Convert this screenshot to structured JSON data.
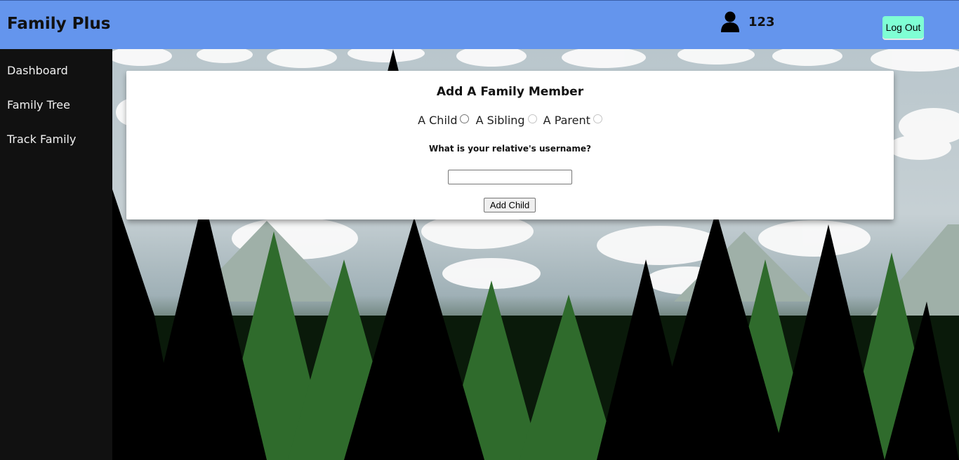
{
  "header": {
    "brand": "Family Plus",
    "user_icon": "user-icon",
    "username": "123",
    "logout_label": "Log Out"
  },
  "sidebar": {
    "items": [
      {
        "label": "Dashboard"
      },
      {
        "label": "Family Tree"
      },
      {
        "label": "Track Family"
      }
    ]
  },
  "form": {
    "title": "Add A Family Member",
    "relation_options": [
      {
        "label": "A Child",
        "selected": false,
        "enabled": true
      },
      {
        "label": "A Sibling",
        "selected": false,
        "enabled": false
      },
      {
        "label": "A Parent",
        "selected": false,
        "enabled": false
      }
    ],
    "question": "What is your relative's username?",
    "username_value": "",
    "submit_label": "Add Child"
  },
  "colors": {
    "header_bg": "#6495ed",
    "sidebar_bg": "#111111",
    "logout_bg": "#7fffd4"
  }
}
